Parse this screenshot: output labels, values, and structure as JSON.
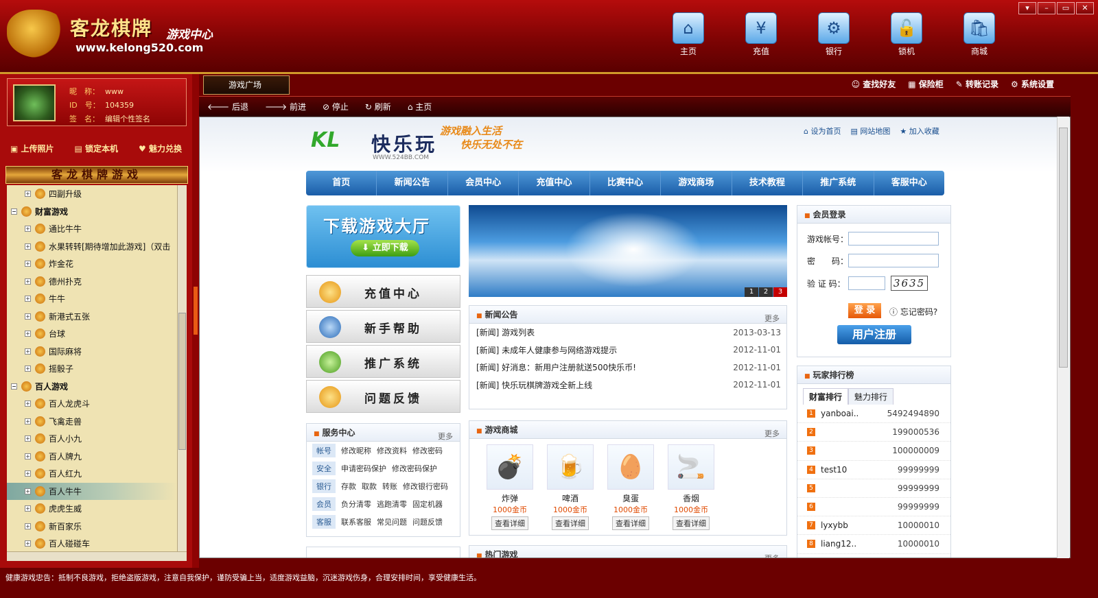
{
  "app": {
    "title": "客龙棋牌",
    "subtitle": "游戏中心",
    "url": "www.kelong520.com"
  },
  "window_controls": [
    "▾",
    "–",
    "▭",
    "✕"
  ],
  "top_nav": [
    {
      "label": "主页",
      "icon": "home-icon"
    },
    {
      "label": "充值",
      "icon": "recharge-icon"
    },
    {
      "label": "银行",
      "icon": "bank-icon"
    },
    {
      "label": "锁机",
      "icon": "lock-icon"
    },
    {
      "label": "商城",
      "icon": "shop-icon"
    }
  ],
  "profile": {
    "nickname_label": "昵　称：",
    "nickname": "www",
    "id_label": "ID　号：",
    "id": "104359",
    "sign_label": "签　名：",
    "sign": "编辑个性签名"
  },
  "profile_actions": [
    "上传照片",
    "锁定本机",
    "魅力兑换"
  ],
  "game_header": "客龙棋牌游戏",
  "tree": [
    {
      "label": "四副升级",
      "type": "game"
    },
    {
      "label": "财富游戏",
      "type": "cat"
    },
    {
      "label": "通比牛牛",
      "type": "game"
    },
    {
      "label": "水果转转[期待增加此游戏]（双击",
      "type": "game"
    },
    {
      "label": "炸金花",
      "type": "game"
    },
    {
      "label": "德州扑克",
      "type": "game"
    },
    {
      "label": "牛牛",
      "type": "game"
    },
    {
      "label": "新港式五张",
      "type": "game"
    },
    {
      "label": "台球",
      "type": "game"
    },
    {
      "label": "国际麻将",
      "type": "game"
    },
    {
      "label": "摇骰子",
      "type": "game"
    },
    {
      "label": "百人游戏",
      "type": "cat"
    },
    {
      "label": "百人龙虎斗",
      "type": "game"
    },
    {
      "label": "飞禽走兽",
      "type": "game"
    },
    {
      "label": "百人小九",
      "type": "game"
    },
    {
      "label": "百人牌九",
      "type": "game"
    },
    {
      "label": "百人红九",
      "type": "game"
    },
    {
      "label": "百人牛牛",
      "type": "game",
      "selected": true
    },
    {
      "label": "虎虎生威",
      "type": "game"
    },
    {
      "label": "新百家乐",
      "type": "game"
    },
    {
      "label": "百人碰碰车",
      "type": "game"
    }
  ],
  "tab": {
    "label": "游戏广场"
  },
  "tool_links": [
    "查找好友",
    "保险柜",
    "转账记录",
    "系统设置"
  ],
  "browser_nav": [
    "后退",
    "前进",
    "停止",
    "刷新",
    "主页"
  ],
  "web": {
    "logo_kl": "KL",
    "logo_cn": "快乐玩",
    "logo_url": "WWW.524BB.COM",
    "slogan": [
      "游戏融入生活",
      "快乐无处不在"
    ],
    "top_links": [
      "设为首页",
      "网站地图",
      "加入收藏"
    ],
    "nav": [
      "首页",
      "新闻公告",
      "会员中心",
      "充值中心",
      "比赛中心",
      "游戏商场",
      "技术教程",
      "推广系统",
      "客服中心"
    ],
    "download_title": "下载游戏大厅",
    "download_button": "立即下载",
    "side_buttons": [
      "充值中心",
      "新手帮助",
      "推广系统",
      "问题反馈"
    ],
    "service": {
      "title": "服务中心",
      "more": "更多",
      "rows": [
        {
          "tag": "帐号",
          "links": [
            "修改昵称",
            "修改资料",
            "修改密码"
          ]
        },
        {
          "tag": "安全",
          "links": [
            "申请密码保护",
            "修改密码保护"
          ]
        },
        {
          "tag": "银行",
          "links": [
            "存款",
            "取款",
            "转账",
            "修改银行密码"
          ]
        },
        {
          "tag": "会员",
          "links": [
            "负分清零",
            "逃跑清零",
            "固定机器"
          ]
        },
        {
          "tag": "客服",
          "links": [
            "联系客服",
            "常见问题",
            "问题反馈"
          ]
        }
      ]
    },
    "banner_pages": [
      "1",
      "2",
      "3"
    ],
    "news": {
      "title": "新闻公告",
      "more": "更多",
      "items": [
        {
          "text": "[新闻] 游戏列表",
          "date": "2013-03-13"
        },
        {
          "text": "[新闻] 未成年人健康参与网络游戏提示",
          "date": "2012-11-01"
        },
        {
          "text": "[新闻] 好消息：新用户注册就送500快乐币!",
          "date": "2012-11-01"
        },
        {
          "text": "[新闻] 快乐玩棋牌游戏全新上线",
          "date": "2012-11-01"
        }
      ]
    },
    "shop": {
      "title": "游戏商城",
      "more": "更多",
      "items": [
        {
          "name": "炸弹",
          "price": "1000金币",
          "detail": "查看详细",
          "icon": "💣"
        },
        {
          "name": "啤酒",
          "price": "1000金币",
          "detail": "查看详细",
          "icon": "🍺"
        },
        {
          "name": "臭蛋",
          "price": "1000金币",
          "detail": "查看详细",
          "icon": "🥚"
        },
        {
          "name": "香烟",
          "price": "1000金币",
          "detail": "查看详细",
          "icon": "🚬"
        }
      ]
    },
    "hot": {
      "title": "热门游戏",
      "more": "更多"
    },
    "login": {
      "title": "会员登录",
      "account_label": "游戏帐号：",
      "password_label": "密　　码：",
      "captcha_label": "验 证 码：",
      "captcha": "3635",
      "login_btn": "登 录",
      "forgot": "忘记密码?",
      "register_btn": "用户注册"
    },
    "rank": {
      "title": "玩家排行榜",
      "tabs": [
        "财富排行",
        "魅力排行"
      ],
      "rows": [
        {
          "no": "1",
          "name": "yanboai..",
          "score": "5492494890"
        },
        {
          "no": "2",
          "name": "",
          "score": "199000536"
        },
        {
          "no": "3",
          "name": "",
          "score": "100000009"
        },
        {
          "no": "4",
          "name": "test10",
          "score": "99999999"
        },
        {
          "no": "5",
          "name": "",
          "score": "99999999"
        },
        {
          "no": "6",
          "name": "",
          "score": "99999999"
        },
        {
          "no": "7",
          "name": "lyxybb",
          "score": "10000010"
        },
        {
          "no": "8",
          "name": "liang12..",
          "score": "10000010"
        }
      ]
    }
  },
  "status_text": "健康游戏忠告：抵制不良游戏，拒绝盗版游戏，注意自我保护，谨防受骗上当，适度游戏益脑，沉迷游戏伤身，合理安排时间，享受健康生活。"
}
